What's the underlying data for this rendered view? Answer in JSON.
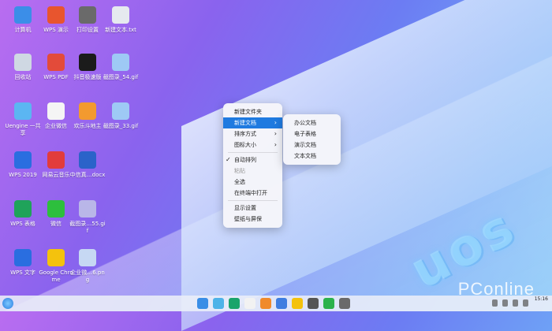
{
  "desktop": {
    "icons": [
      {
        "label": "计算机",
        "icon": "computer-icon",
        "color": "#3b8ee8"
      },
      {
        "label": "WPS 演示",
        "icon": "wps-presentation-icon",
        "color": "#e8552e"
      },
      {
        "label": "打印设置",
        "icon": "printer-icon",
        "color": "#6a6a6a"
      },
      {
        "label": "新建文本.txt",
        "icon": "text-file-icon",
        "color": "#e6e9ef"
      },
      {
        "label": "回收站",
        "icon": "trash-icon",
        "color": "#cfd8e3"
      },
      {
        "label": "WPS PDF",
        "icon": "wps-pdf-icon",
        "color": "#e34b3a"
      },
      {
        "label": "抖音极速版",
        "icon": "douyin-icon",
        "color": "#1b1b1b"
      },
      {
        "label": "截图录_54.gif",
        "icon": "image-file-icon",
        "color": "#9ec9f5"
      },
      {
        "label": "Uengine 一共享",
        "icon": "folder-icon",
        "color": "#5bb6f2"
      },
      {
        "label": "企业微信",
        "icon": "wecom-icon",
        "color": "#f5f5f5"
      },
      {
        "label": "欢乐斗地主",
        "icon": "game-icon",
        "color": "#f39a2f"
      },
      {
        "label": "截图录_33.gif",
        "icon": "image-file-icon",
        "color": "#9ec9f5"
      },
      {
        "label": "WPS 2019",
        "icon": "wps-icon",
        "color": "#2a6ee0"
      },
      {
        "label": "网易云音乐",
        "icon": "netease-music-icon",
        "color": "#e23c3c"
      },
      {
        "label": "中信真…docx",
        "icon": "docx-file-icon",
        "color": "#2b63c9"
      },
      {
        "label": "WPS 表格",
        "icon": "wps-sheet-icon",
        "color": "#1fa35a"
      },
      {
        "label": "微信",
        "icon": "wechat-icon",
        "color": "#2dbf3d"
      },
      {
        "label": "截图录…55.gif",
        "icon": "image-file-icon",
        "color": "#b9b6e8"
      },
      {
        "label": "WPS 文字",
        "icon": "wps-writer-icon",
        "color": "#2a6ee0"
      },
      {
        "label": "Google Chrome",
        "icon": "chrome-icon",
        "color": "#f4c20d"
      },
      {
        "label": "企业微…6.png",
        "icon": "image-file-icon",
        "color": "#c6d8f3"
      }
    ]
  },
  "context_menu": {
    "items": [
      {
        "label": "新建文件夹"
      },
      {
        "label": "新建文档",
        "submenu": true,
        "active": true
      },
      {
        "label": "排序方式",
        "submenu": true
      },
      {
        "label": "图标大小",
        "submenu": true
      },
      {
        "label": "自动排列",
        "checked": true
      },
      {
        "label": "粘贴",
        "disabled": true
      },
      {
        "label": "全选"
      },
      {
        "label": "在终端中打开"
      },
      {
        "label": "显示设置"
      },
      {
        "label": "壁纸与屏保"
      }
    ]
  },
  "submenu": {
    "items": [
      "办公文档",
      "电子表格",
      "演示文档",
      "文本文档"
    ]
  },
  "wallpaper": {
    "logo": "uos"
  },
  "watermark": "PConline",
  "taskbar": {
    "apps": [
      "file-manager-icon",
      "photos-icon",
      "music-icon",
      "calendar-icon",
      "app-store-icon",
      "settings-icon",
      "chrome-icon",
      "printer-icon",
      "screenshot-icon",
      "search-icon"
    ],
    "clock_time": "15:16"
  },
  "colors": {
    "accent": "#1f7ae0"
  }
}
